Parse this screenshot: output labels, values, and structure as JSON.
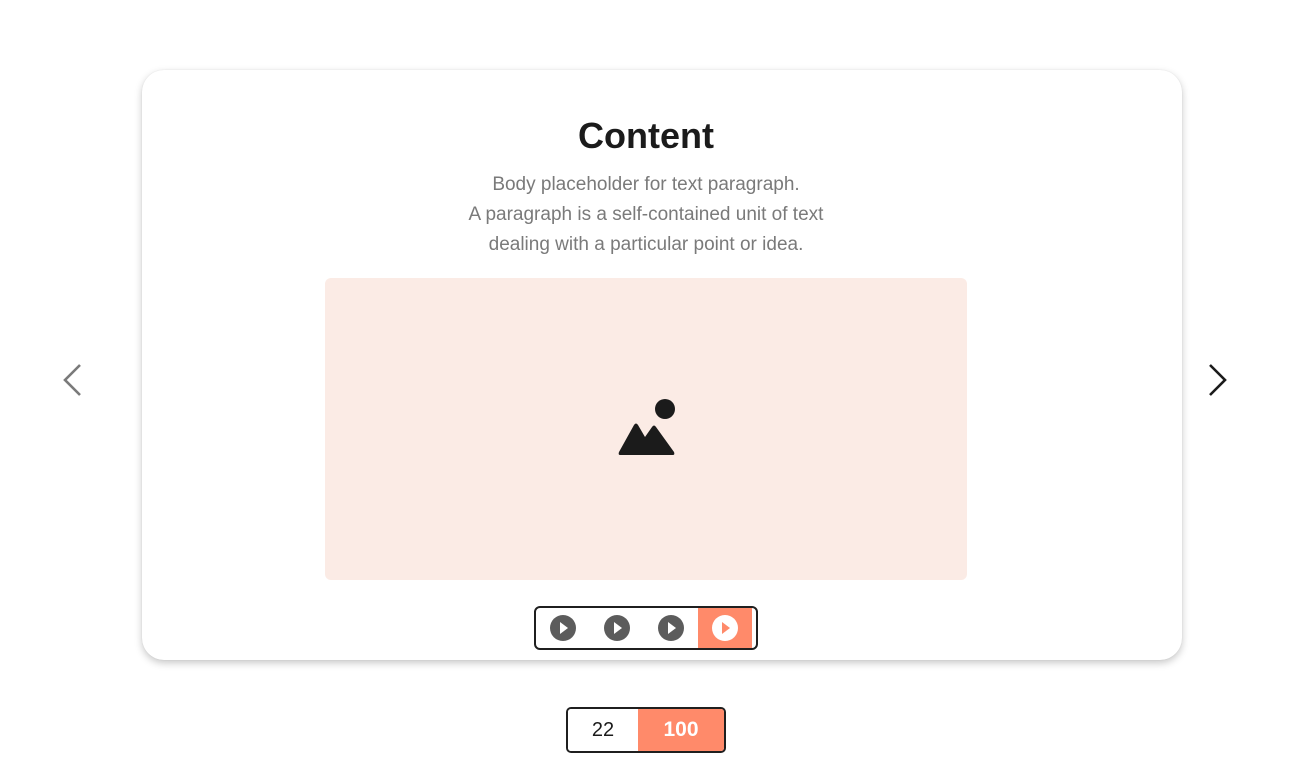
{
  "content": {
    "title": "Content",
    "body_lines": [
      "Body placeholder for text paragraph.",
      "A paragraph is a self-contained unit of text",
      "dealing with a particular point or idea."
    ],
    "image_icon": "image-placeholder-icon",
    "image_background_color": "#fbebe5"
  },
  "navigation": {
    "prev_icon": "chevron-left-icon",
    "next_icon": "chevron-right-icon"
  },
  "pagination_dots": {
    "items": [
      {
        "icon": "play-circle-icon",
        "active": false
      },
      {
        "icon": "play-circle-icon",
        "active": false
      },
      {
        "icon": "play-circle-icon",
        "active": false
      },
      {
        "icon": "play-circle-icon",
        "active": true
      }
    ],
    "active_color": "#ff8a6a"
  },
  "counter": {
    "current": "22",
    "total": "100",
    "accent_color": "#ff8a6a"
  }
}
